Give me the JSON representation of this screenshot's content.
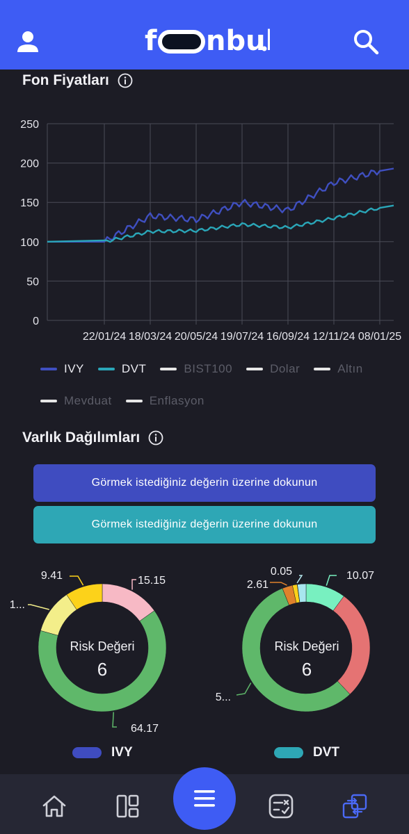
{
  "header": {
    "logo_text": "fonbul",
    "profile_icon": "user-icon",
    "search_icon": "search-icon",
    "brand_color": "#3e5cf4"
  },
  "fund_prices": {
    "title": "Fon Fiyatları",
    "info_icon": "info-icon"
  },
  "chart_data": {
    "type": "line",
    "x": [
      "22/01/24",
      "18/03/24",
      "20/05/24",
      "19/07/24",
      "16/09/24",
      "12/11/24",
      "08/01/25"
    ],
    "ylim": [
      0,
      250
    ],
    "yticks": [
      0,
      50,
      100,
      150,
      200,
      250
    ],
    "grid": true,
    "legend_position": "bottom",
    "series": [
      {
        "name": "IVY",
        "color": "#3f4fc0",
        "values": [
          100,
          133,
          128,
          150,
          140,
          175,
          190
        ]
      },
      {
        "name": "DVT",
        "color": "#2aa6b8",
        "values": [
          100,
          113,
          114,
          122,
          118,
          130,
          143
        ]
      }
    ]
  },
  "legend": [
    {
      "label": "IVY",
      "color": "#3f4fc0",
      "active": true
    },
    {
      "label": "DVT",
      "color": "#2aa6b8",
      "active": true
    },
    {
      "label": "BIST100",
      "color": "#e6e6e6",
      "active": false
    },
    {
      "label": "Dolar",
      "color": "#e6e6e6",
      "active": false
    },
    {
      "label": "Altın",
      "color": "#e6e6e6",
      "active": false
    },
    {
      "label": "Mevduat",
      "color": "#e6e6e6",
      "active": false
    },
    {
      "label": "Enflasyon",
      "color": "#e6e6e6",
      "active": false
    }
  ],
  "asset_allocation": {
    "title": "Varlık Dağılımları",
    "button1_label": "Görmek istediğiniz değerin üzerine dokunun",
    "button2_label": "Görmek istediğiniz değerin üzerine dokunun",
    "button1_color": "#3f4cc0",
    "button2_color": "#2ea7b5",
    "risk_label": "Risk Değeri",
    "ivy": {
      "name": "IVY",
      "risk_value": "6",
      "slices": [
        {
          "value": 15.15,
          "label": "15.15",
          "color": "#f7b9c5"
        },
        {
          "value": 64.17,
          "label": "64.17",
          "color": "#5fb86a"
        },
        {
          "value": 11.27,
          "label": "1...",
          "color": "#f3ee8a"
        },
        {
          "value": 9.41,
          "label": "9.41",
          "color": "#fcd21a"
        }
      ]
    },
    "dvt": {
      "name": "DVT",
      "risk_value": "6",
      "slices": [
        {
          "value": 10.07,
          "label": "10.07",
          "color": "#78f0c0"
        },
        {
          "value": 27.9,
          "label": "",
          "color": "#e57373"
        },
        {
          "value": 56.0,
          "label": "5...",
          "color": "#5fb86a"
        },
        {
          "value": 2.61,
          "label": "2.61",
          "color": "#e0822c"
        },
        {
          "value": 1.2,
          "label": "",
          "color": "#fcd21a"
        },
        {
          "value": 0.05,
          "label": "0.05",
          "color": "#b7e8ef"
        },
        {
          "value": 2.17,
          "label": "",
          "color": "#a8e6ef"
        }
      ]
    }
  },
  "nav": {
    "home_icon": "home-icon",
    "dashboard_icon": "dashboard-icon",
    "menu_icon": "menu-icon",
    "filter_icon": "filter-icon",
    "compare_icon": "compare-icon"
  }
}
